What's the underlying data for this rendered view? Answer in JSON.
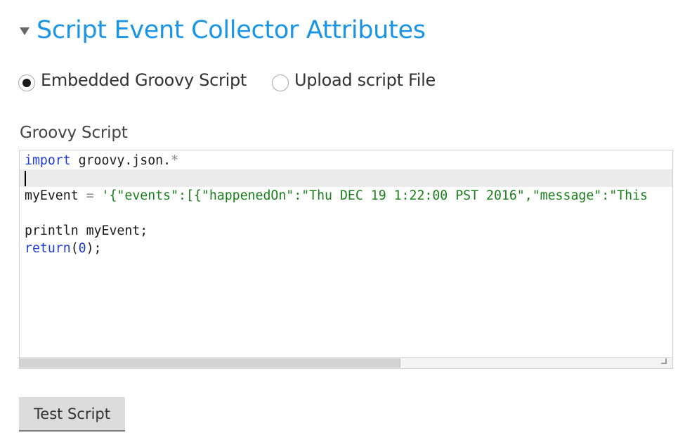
{
  "section": {
    "title": "Script Event Collector Attributes",
    "expanded": true
  },
  "radio_group": {
    "options": [
      {
        "label": "Embedded Groovy Script",
        "checked": true
      },
      {
        "label": "Upload script File",
        "checked": false
      }
    ]
  },
  "editor": {
    "label": "Groovy Script",
    "active_line": 2,
    "lines": [
      [
        {
          "t": "import",
          "c": "kw"
        },
        {
          "t": " groovy.json.",
          "c": ""
        },
        {
          "t": "*",
          "c": "op"
        }
      ],
      [],
      [
        {
          "t": "myEvent ",
          "c": ""
        },
        {
          "t": "=",
          "c": "op"
        },
        {
          "t": " ",
          "c": ""
        },
        {
          "t": "'{\"events\":[{\"happenedOn\":\"Thu DEC 19 1:22:00 PST 2016\",\"message\":\"This",
          "c": "str"
        }
      ],
      [],
      [
        {
          "t": "println myEvent;",
          "c": ""
        }
      ],
      [
        {
          "t": "return",
          "c": "kw"
        },
        {
          "t": "(",
          "c": ""
        },
        {
          "t": "0",
          "c": "num"
        },
        {
          "t": ");",
          "c": ""
        }
      ]
    ]
  },
  "actions": {
    "test_button_label": "Test Script"
  },
  "colors": {
    "accent": "#1a94e6",
    "keyword": "#1f3bd6",
    "string": "#1a7f1a"
  }
}
